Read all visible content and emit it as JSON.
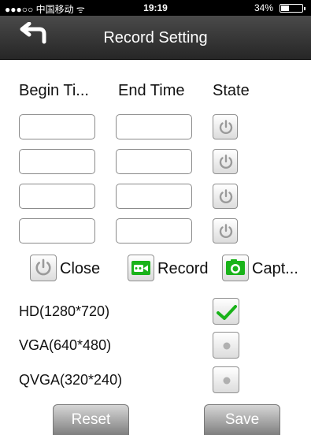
{
  "status_bar": {
    "carrier": "●●●○○ 中国移动 ᯤ",
    "time": "19:19",
    "battery": "34%",
    "battery_level": 0.34
  },
  "nav": {
    "title": "Record Setting",
    "back_icon": "back-arrow-icon"
  },
  "columns": {
    "begin": "Begin Ti...",
    "end": "End Time",
    "state": "State"
  },
  "schedule": [
    {
      "begin": "",
      "end": "",
      "state": "close"
    },
    {
      "begin": "",
      "end": "",
      "state": "close"
    },
    {
      "begin": "",
      "end": "",
      "state": "close"
    },
    {
      "begin": "",
      "end": "",
      "state": "close"
    }
  ],
  "legend": [
    {
      "icon": "power-icon",
      "label": "Close"
    },
    {
      "icon": "video-camera-icon",
      "label": "Record"
    },
    {
      "icon": "photo-camera-icon",
      "label": "Capt..."
    }
  ],
  "resolutions": [
    {
      "label": "HD(1280*720)",
      "selected": true
    },
    {
      "label": "VGA(640*480)",
      "selected": false
    },
    {
      "label": "QVGA(320*240)",
      "selected": false
    }
  ],
  "buttons": {
    "reset": "Reset",
    "save": "Save"
  },
  "colors": {
    "accent_green": "#19b319",
    "nav_bg": "#333333",
    "button_gray": "#9a9a9a"
  }
}
